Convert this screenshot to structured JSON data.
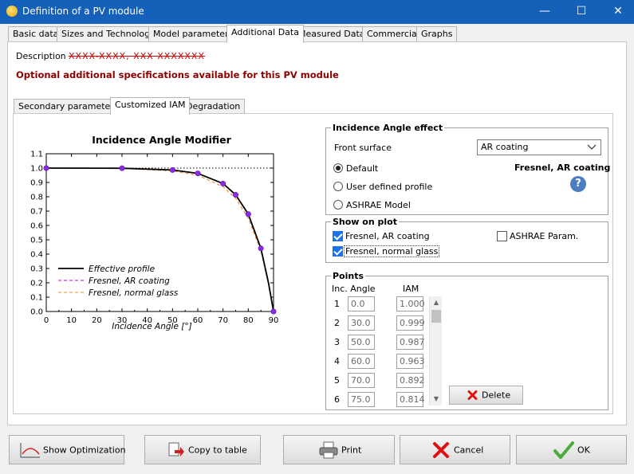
{
  "window": {
    "title": "Definition of a PV module",
    "minimize": "—",
    "maximize": "☐",
    "close": "✕"
  },
  "main_tabs": [
    "Basic data",
    "Sizes and Technology",
    "Model parameters",
    "Additional Data",
    "Measured Data",
    "Commercial",
    "Graphs"
  ],
  "description_label": "Description",
  "description_value": "XXXX-XXXX, XXX XXXXXXX",
  "notice": "Optional additional specifications available for this PV module",
  "sub_tabs": [
    "Secondary parameters",
    "Customized IAM",
    "Degradation"
  ],
  "iam_group": {
    "title": "Incidence Angle effect",
    "front_label": "Front surface",
    "front_value": "AR coating",
    "opt_default": "Default",
    "opt_user": "User defined profile",
    "opt_ashrae": "ASHRAE Model",
    "model_name": "Fresnel, AR coating",
    "help": "?"
  },
  "plot_group": {
    "title": "Show on plot",
    "chk1": "Fresnel, AR coating",
    "chk2": "Fresnel, normal glass",
    "chk3": "ASHRAE Param."
  },
  "points_group": {
    "title": "Points",
    "col_angle": "Inc. Angle",
    "col_iam": "IAM",
    "rows": [
      {
        "i": "1",
        "angle": "0.0",
        "iam": "1.000"
      },
      {
        "i": "2",
        "angle": "30.0",
        "iam": "0.999"
      },
      {
        "i": "3",
        "angle": "50.0",
        "iam": "0.987"
      },
      {
        "i": "4",
        "angle": "60.0",
        "iam": "0.963"
      },
      {
        "i": "5",
        "angle": "70.0",
        "iam": "0.892"
      },
      {
        "i": "6",
        "angle": "75.0",
        "iam": "0.814"
      }
    ],
    "delete": "Delete"
  },
  "buttons": {
    "optimization": "Show Optimization",
    "copy": "Copy to table",
    "print": "Print",
    "cancel": "Cancel",
    "ok": "OK"
  },
  "chart_data": {
    "type": "line",
    "title": "Incidence Angle Modifier",
    "xlabel": "Incidence Angle [°]",
    "ylabel": "",
    "xlim": [
      0,
      90
    ],
    "ylim": [
      0,
      1.1
    ],
    "xticks": [
      "0",
      "10",
      "20",
      "30",
      "40",
      "50",
      "60",
      "70",
      "80",
      "90"
    ],
    "yticks": [
      "0.0",
      "0.1",
      "0.2",
      "0.3",
      "0.4",
      "0.5",
      "0.6",
      "0.7",
      "0.8",
      "0.9",
      "1.0",
      "1.1"
    ],
    "legend": "bottom-left",
    "series": [
      {
        "name": "Effective profile",
        "color": "#000000",
        "style": "solid",
        "x": [
          0,
          30,
          50,
          60,
          70,
          75,
          80,
          85,
          88,
          90
        ],
        "y": [
          1.0,
          0.999,
          0.987,
          0.963,
          0.892,
          0.814,
          0.679,
          0.44,
          0.2,
          0.0
        ]
      },
      {
        "name": "Fresnel, AR coating",
        "color": "#cc00cc",
        "style": "dashed",
        "x": [
          0,
          30,
          50,
          60,
          70,
          75,
          80,
          85,
          88,
          90
        ],
        "y": [
          1.0,
          0.999,
          0.987,
          0.963,
          0.892,
          0.814,
          0.679,
          0.44,
          0.2,
          0.0
        ]
      },
      {
        "name": "Fresnel, normal glass",
        "color": "#f08c2a",
        "style": "dashed",
        "x": [
          0,
          30,
          50,
          60,
          70,
          75,
          80,
          85,
          88,
          90
        ],
        "y": [
          1.0,
          0.998,
          0.98,
          0.95,
          0.87,
          0.79,
          0.65,
          0.42,
          0.19,
          0.0
        ]
      }
    ],
    "points": {
      "color": "#8a2be2",
      "x": [
        0,
        30,
        50,
        60,
        70,
        75,
        80,
        85,
        90
      ],
      "y": [
        1.0,
        0.999,
        0.987,
        0.963,
        0.892,
        0.814,
        0.679,
        0.44,
        0.0
      ]
    },
    "reference_line": {
      "y": 1.0,
      "style": "dotted"
    }
  }
}
